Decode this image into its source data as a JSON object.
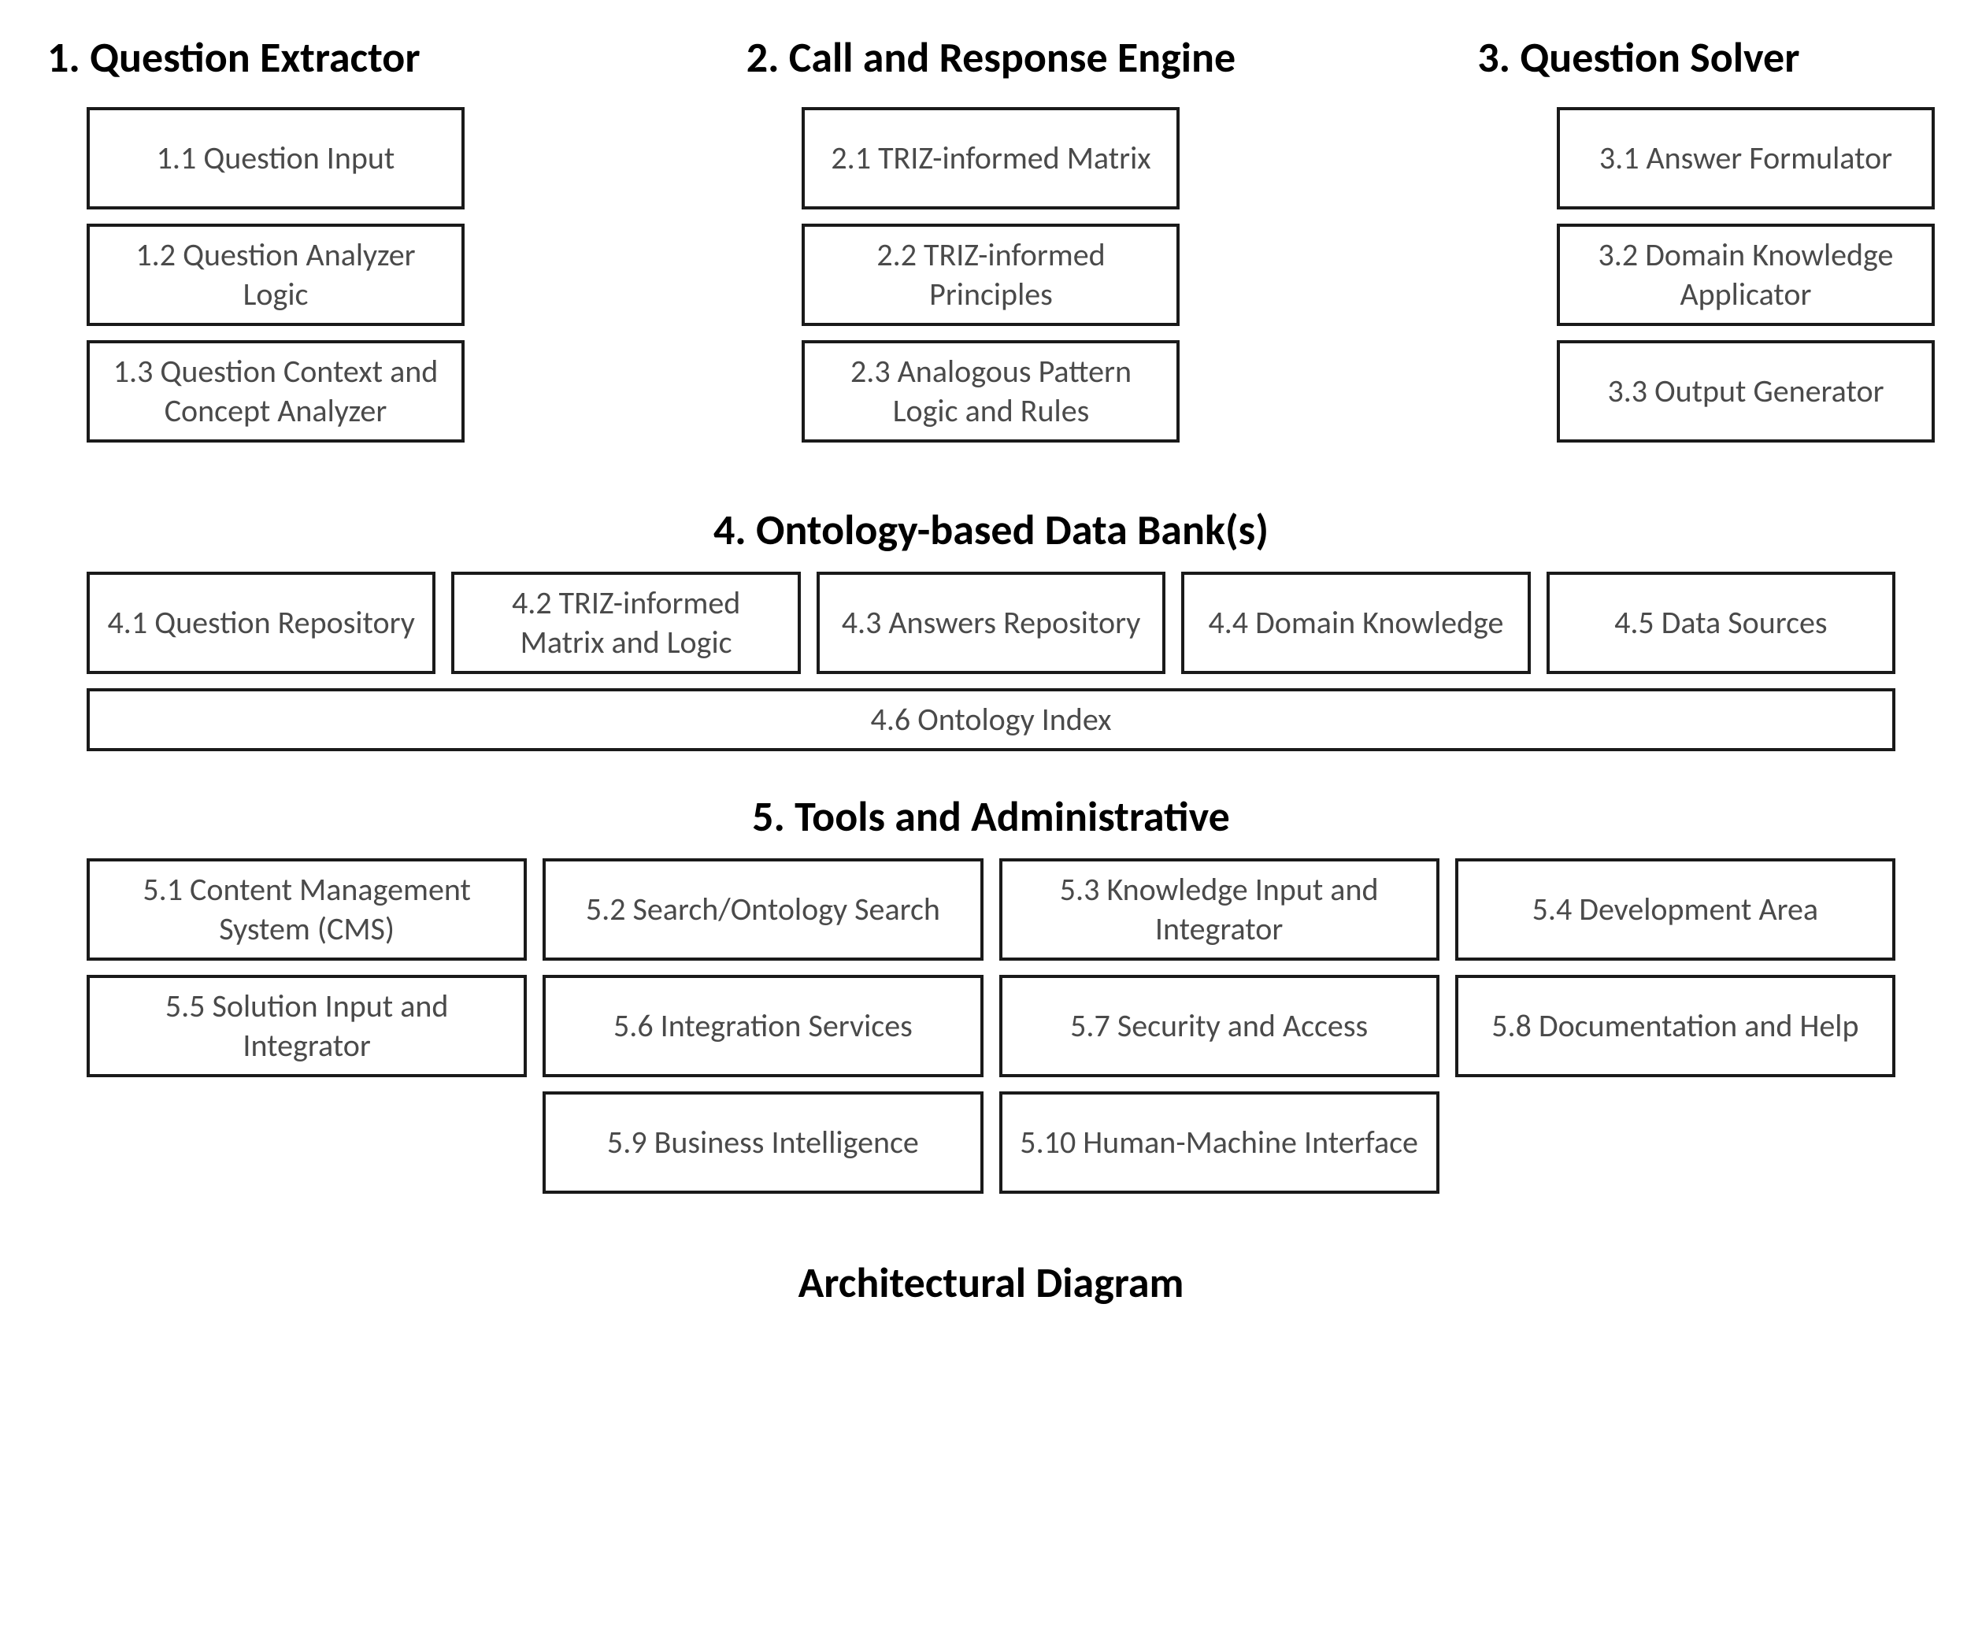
{
  "sections": {
    "s1": {
      "title": "1. Question Extractor",
      "boxes": [
        "1.1 Question Input",
        "1.2 Question Analyzer Logic",
        "1.3 Question Context and Concept Analyzer"
      ]
    },
    "s2": {
      "title": "2. Call and Response Engine",
      "boxes": [
        "2.1 TRIZ-informed Matrix",
        "2.2 TRIZ-informed Principles",
        "2.3 Analogous Pattern Logic  and Rules"
      ]
    },
    "s3": {
      "title": "3. Question Solver",
      "boxes": [
        "3.1 Answer Formulator",
        "3.2 Domain Knowledge Applicator",
        "3.3 Output Generator"
      ]
    },
    "s4": {
      "title": "4. Ontology-based Data Bank(s)",
      "row1": [
        "4.1 Question Repository",
        "4.2 TRIZ-informed Matrix and Logic",
        "4.3 Answers Repository",
        "4.4 Domain Knowledge",
        "4.5 Data Sources"
      ],
      "row2": "4.6 Ontology Index"
    },
    "s5": {
      "title": "5. Tools and Administrative",
      "row1": [
        "5.1 Content Management System (CMS)",
        "5.2 Search/Ontology Search",
        "5.3 Knowledge Input and Integrator",
        "5.4 Development Area"
      ],
      "row2": [
        "5.5 Solution  Input and Integrator",
        "5.6 Integration Services",
        "5.7 Security and Access",
        "5.8 Documentation and Help"
      ],
      "row3": [
        "5.9 Business Intelligence",
        "5.10 Human-Machine Interface"
      ]
    }
  },
  "footer": "Architectural Diagram"
}
